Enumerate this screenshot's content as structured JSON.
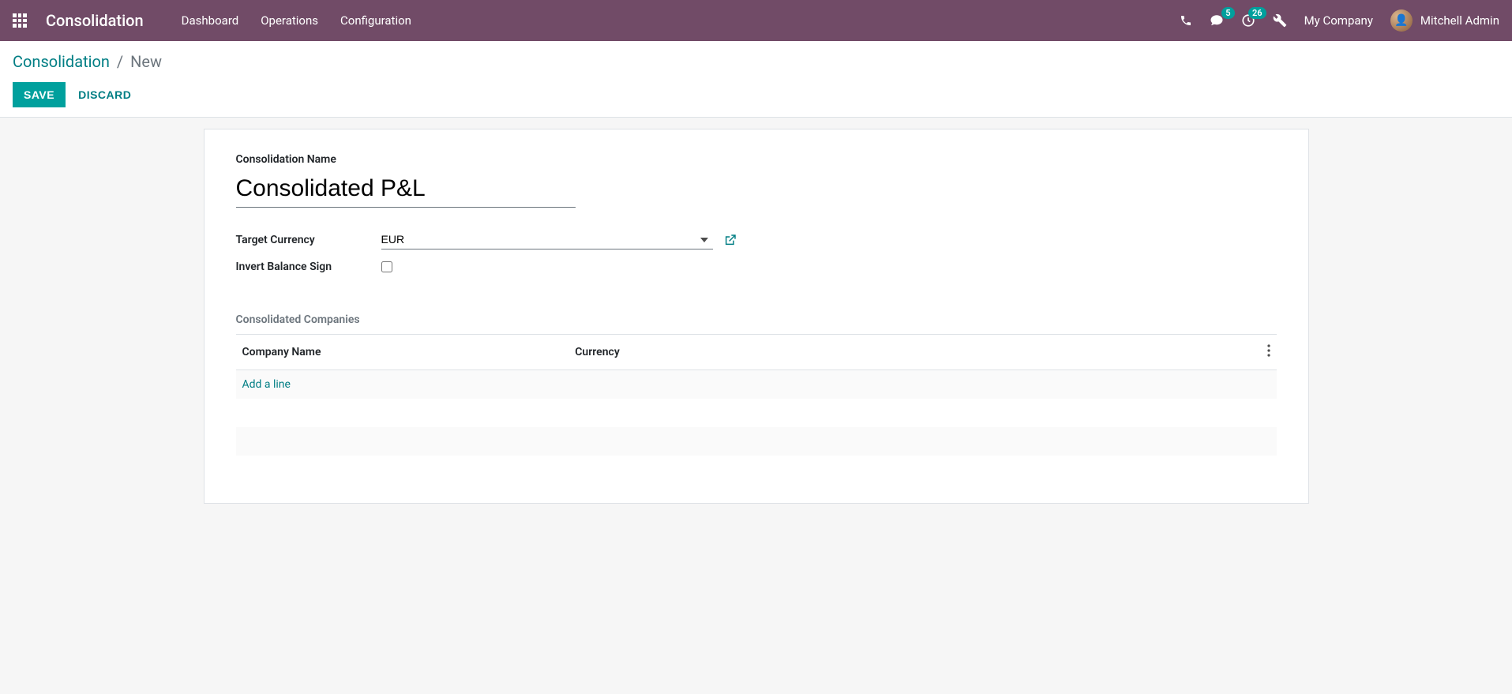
{
  "navbar": {
    "brand": "Consolidation",
    "menu": [
      "Dashboard",
      "Operations",
      "Configuration"
    ],
    "conversations_badge": "5",
    "activities_badge": "26",
    "company": "My Company",
    "user": "Mitchell Admin"
  },
  "breadcrumb": {
    "root": "Consolidation",
    "current": "New"
  },
  "buttons": {
    "save": "SAVE",
    "discard": "DISCARD"
  },
  "form": {
    "name_label": "Consolidation Name",
    "name_value": "Consolidated P&L",
    "currency_label": "Target Currency",
    "currency_value": "EUR",
    "invert_label": "Invert Balance Sign",
    "invert_value": false
  },
  "notebook": {
    "tab_label": "Consolidated Companies",
    "columns": {
      "company": "Company Name",
      "currency": "Currency"
    },
    "add_line": "Add a line"
  }
}
